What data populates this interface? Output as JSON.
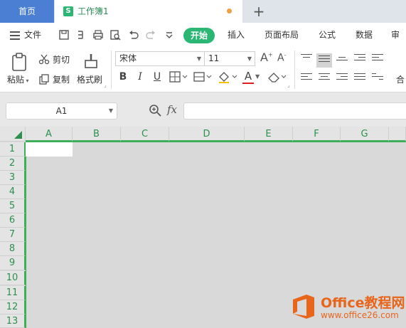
{
  "tabbar": {
    "home_label": "首页",
    "doc_icon_letter": "S",
    "doc_title": "工作簿1",
    "add_label": "+"
  },
  "menu": {
    "file_label": "文件",
    "tabs": [
      "开始",
      "插入",
      "页面布局",
      "公式",
      "数据",
      "审阅"
    ],
    "active_tab": "开始"
  },
  "ribbon": {
    "paste_label": "粘贴",
    "cut_label": "剪切",
    "copy_label": "复制",
    "format_painter_label": "格式刷",
    "font_name": "宋体",
    "font_size": "11",
    "merge_label": "合"
  },
  "formula_bar": {
    "cell_ref": "A1",
    "fx_label": "fx",
    "formula_value": ""
  },
  "sheet": {
    "columns": [
      "A",
      "B",
      "C",
      "D",
      "E",
      "F",
      "G"
    ],
    "rows": [
      "1",
      "2",
      "3",
      "4",
      "5",
      "6",
      "7",
      "8",
      "9",
      "10",
      "11",
      "12",
      "13"
    ],
    "selected_cell": "A1"
  },
  "watermark": {
    "name": "Office教程网",
    "url": "www.office26.com"
  },
  "colors": {
    "accent_green": "#2bb673",
    "home_tab_blue": "#4a7fd4",
    "header_text_green": "#2d8f4f",
    "watermark_orange": "#e8651c"
  }
}
